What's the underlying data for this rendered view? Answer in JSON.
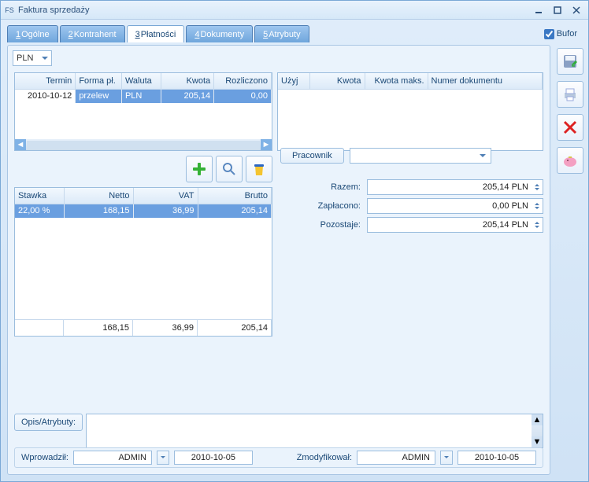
{
  "window": {
    "title": "Faktura sprzedaży",
    "icon": "FS"
  },
  "tabs": [
    {
      "u": "1",
      "label": " Ogólne"
    },
    {
      "u": "2",
      "label": " Kontrahent"
    },
    {
      "u": "3",
      "label": " Płatności"
    },
    {
      "u": "4",
      "label": " Dokumenty"
    },
    {
      "u": "5",
      "label": " Atrybuty"
    }
  ],
  "bufor_label": "Bufor",
  "currency": "PLN",
  "payments_headers": {
    "termin": "Termin",
    "forma": "Forma pł.",
    "waluta": "Waluta",
    "kwota": "Kwota",
    "rozliczono": "Rozliczono"
  },
  "payments_row": {
    "termin": "2010-10-12",
    "forma": "przelew",
    "waluta": "PLN",
    "kwota": "205,14",
    "rozliczono": "0,00"
  },
  "docs_headers": {
    "uzyj": "Użyj",
    "kwota": "Kwota",
    "kwmaks": "Kwota maks.",
    "numer": "Numer dokumentu"
  },
  "pracownik_label": "Pracownik",
  "sums": {
    "razem_label": "Razem:",
    "razem_val": "205,14 PLN",
    "zapl_label": "Zapłacono:",
    "zapl_val": "0,00 PLN",
    "poz_label": "Pozostaje:",
    "poz_val": "205,14 PLN"
  },
  "vat_headers": {
    "stawka": "Stawka",
    "netto": "Netto",
    "vat": "VAT",
    "brutto": "Brutto"
  },
  "vat_row": {
    "stawka": "22,00 %",
    "netto": "168,15",
    "vat": "36,99",
    "brutto": "205,14"
  },
  "vat_footer": {
    "netto": "168,15",
    "vat": "36,99",
    "brutto": "205,14"
  },
  "desc_label": "Opis/Atrybuty:",
  "footer": {
    "wpr_label": "Wprowadził:",
    "wpr_user": "ADMIN",
    "wpr_date": "2010-10-05",
    "zmod_label": "Zmodyfikował:",
    "zmod_user": "ADMIN",
    "zmod_date": "2010-10-05"
  }
}
